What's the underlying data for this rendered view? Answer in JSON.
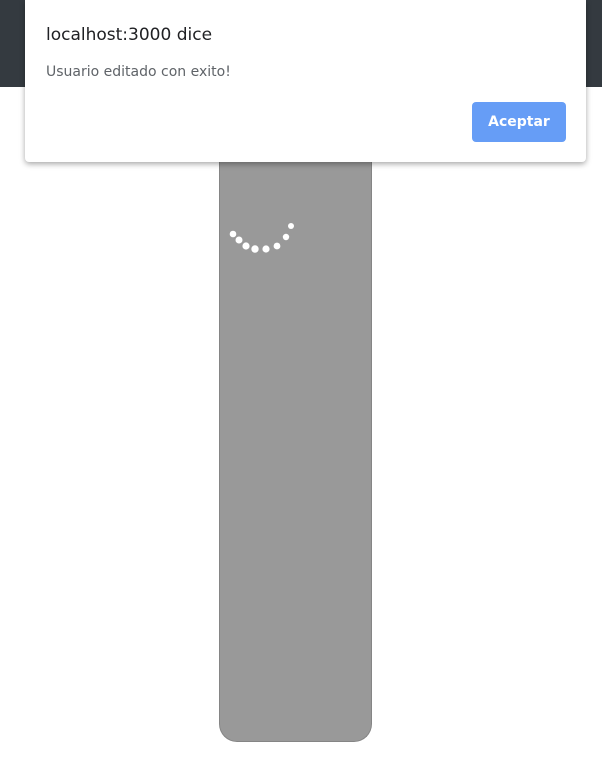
{
  "colors": {
    "topbar": "#343a40",
    "dialog_background": "#ffffff",
    "accept_button": "#669df6",
    "panel": "#999999",
    "spinner": "#ffffff"
  },
  "dialog": {
    "title": "localhost:3000 dice",
    "message": "Usuario editado con exito!",
    "accept_label": "Aceptar"
  },
  "loader": {
    "icon": "loading-spinner-icon"
  }
}
